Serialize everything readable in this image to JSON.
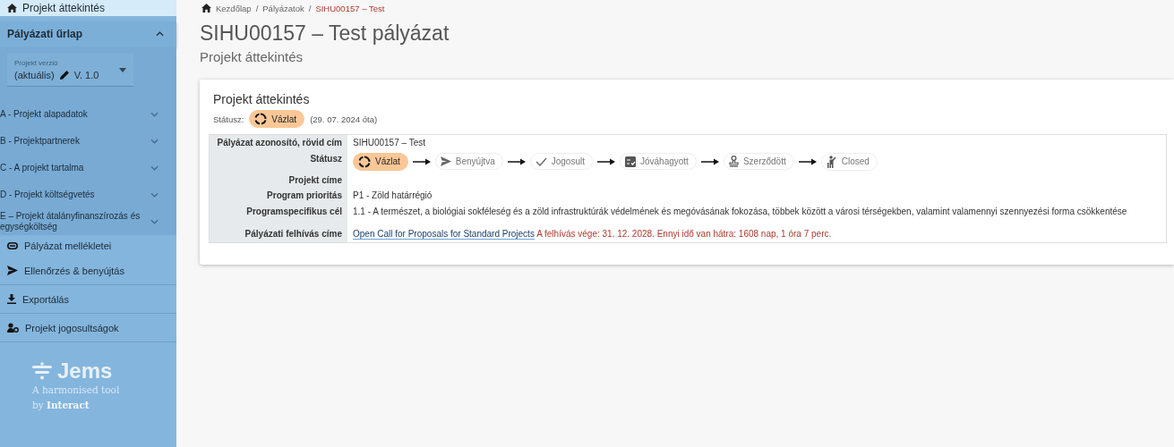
{
  "sidebar": {
    "top_item": {
      "label": "Projekt áttekintés",
      "selected": true
    },
    "section": {
      "title": "Pályázati űrlap",
      "expanded": true
    },
    "version": {
      "label": "Projekt verzió",
      "prefix": "(aktuális)",
      "value": "V. 1.0"
    },
    "form_items": [
      {
        "label": "A - Projekt alapadatok",
        "expanded": false
      },
      {
        "label": "B - Projektpartnerek",
        "expanded": false
      },
      {
        "label": "C - A projekt tartalma",
        "expanded": false
      },
      {
        "label": "D - Projekt költségvetés",
        "expanded": false
      },
      {
        "label": "E – Projekt átalányfinanszírozás és egységköltség",
        "expanded": false
      }
    ],
    "nav_items": [
      {
        "label": "Pályázat mellékletei"
      },
      {
        "label": "Ellenőrzés & benyújtás"
      },
      {
        "label": "Exportálás"
      },
      {
        "label": "Projekt jogosultságok"
      }
    ],
    "logo": {
      "name": "Jems",
      "tagline": "A harmonised tool",
      "by": "by **Interact**"
    }
  },
  "breadcrumb_separator": "/",
  "breadcrumb": [
    {
      "label": "Kezdőlap",
      "current": false
    },
    {
      "label": "Pályázatok",
      "current": false
    },
    {
      "label": "SIHU00157 – Test",
      "current": true
    }
  ],
  "title": "SIHU00157 – Test pályázat",
  "subtitle": "Projekt áttekintés",
  "card": {
    "title": "Projekt áttekintés",
    "status_label": "Státusz:",
    "status": "Vázlat",
    "since": "(29. 07. 2024 óta)",
    "rows": [
      {
        "kind": "text",
        "label": "Pályázat azonosító, rövid cím",
        "value": "SIHU00157 – Test"
      },
      {
        "kind": "status",
        "label": "Státusz",
        "steps": [
          {
            "label": "Vázlat",
            "selected": true
          },
          {
            "label": "Benyújtva",
            "selected": false
          },
          {
            "label": "Jogosult",
            "selected": false
          },
          {
            "label": "Jóváhagyott",
            "selected": false
          },
          {
            "label": "Szerződött",
            "selected": false
          },
          {
            "label": "Closed",
            "selected": false
          }
        ]
      },
      {
        "kind": "text",
        "label": "Projekt címe"
      },
      {
        "kind": "text",
        "label": "Program prioritás",
        "value": "P1 - Zöld határrégió"
      },
      {
        "kind": "text",
        "label": "Programspecifikus cél",
        "value": "1.1 - A természet, a biológiai sokféleség és a zöld infrastruktúrák védelmének és megóvásának fokozása, többek között a városi térségekben, valamint valamennyi szennyezési forma csökkentése"
      },
      {
        "kind": "link",
        "label": "Pályázati felhívás címe",
        "link": "Open Call for Proposals for Standard Projects",
        "note": "A felhívás vége: 31. 12. 2028. Ennyi idő van hátra: 1608 nap, 1 óra 7 perc."
      }
    ]
  }
}
